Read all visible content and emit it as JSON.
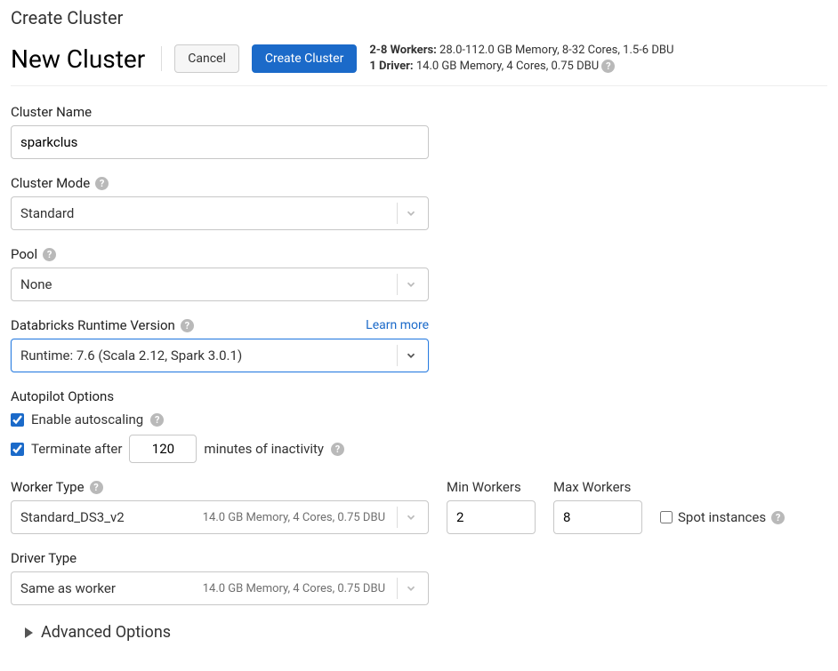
{
  "page": {
    "title": "Create Cluster"
  },
  "header": {
    "title": "New Cluster",
    "cancel": "Cancel",
    "create": "Create Cluster",
    "summary": {
      "workers_label": "2-8 Workers:",
      "workers_detail": "28.0-112.0 GB Memory, 8-32 Cores, 1.5-6 DBU",
      "driver_label": "1 Driver:",
      "driver_detail": "14.0 GB Memory, 4 Cores, 0.75 DBU"
    }
  },
  "cluster_name": {
    "label": "Cluster Name",
    "value": "sparkclus"
  },
  "cluster_mode": {
    "label": "Cluster Mode",
    "value": "Standard"
  },
  "pool": {
    "label": "Pool",
    "value": "None"
  },
  "runtime": {
    "label": "Databricks Runtime Version",
    "learn_more": "Learn more",
    "value": "Runtime: 7.6 (Scala 2.12, Spark 3.0.1)"
  },
  "autopilot": {
    "label": "Autopilot Options",
    "autoscale_label": "Enable autoscaling",
    "autoscale_checked": true,
    "terminate_prefix": "Terminate after",
    "terminate_minutes": "120",
    "terminate_suffix": "minutes of inactivity",
    "terminate_checked": true
  },
  "worker": {
    "label": "Worker Type",
    "value": "Standard_DS3_v2",
    "meta": "14.0 GB Memory, 4 Cores, 0.75 DBU",
    "min_label": "Min Workers",
    "min_value": "2",
    "max_label": "Max Workers",
    "max_value": "8",
    "spot_label": "Spot instances",
    "spot_checked": false
  },
  "driver": {
    "label": "Driver Type",
    "value": "Same as worker",
    "meta": "14.0 GB Memory, 4 Cores, 0.75 DBU"
  },
  "advanced": {
    "label": "Advanced Options"
  }
}
